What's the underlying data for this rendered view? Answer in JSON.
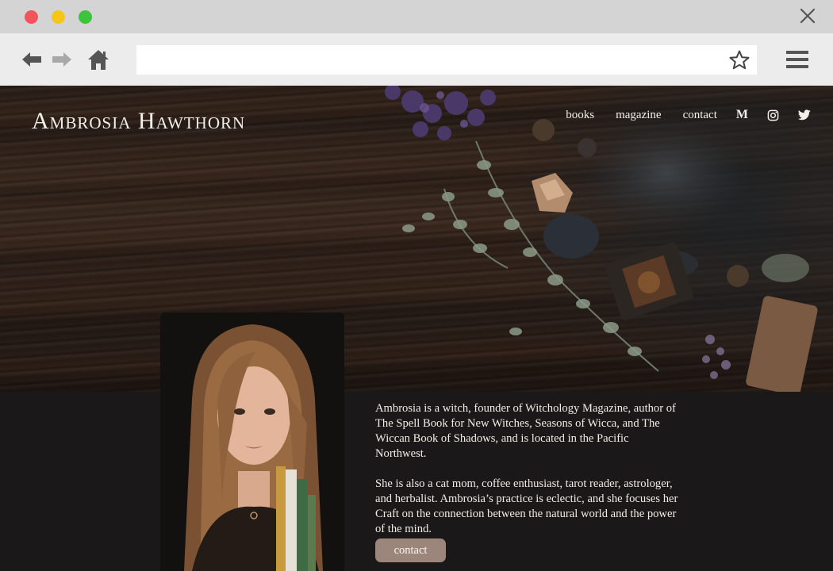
{
  "browser": {
    "url": ""
  },
  "site": {
    "brand": "Ambrosia Hawthorn",
    "nav": {
      "books": "books",
      "magazine": "magazine",
      "contact": "contact",
      "medium": "M"
    },
    "icons": [
      "back-icon",
      "forward-icon",
      "home-icon",
      "star-icon",
      "menu-icon",
      "close-icon",
      "medium-icon",
      "instagram-icon",
      "twitter-icon"
    ],
    "colors": {
      "background": "#1a1818",
      "button": "#9c857b",
      "text": "#f1ede7"
    }
  },
  "bio": {
    "paragraph1": "Ambrosia is a witch, founder of Witchology Magazine, author of The Spell Book for New Witches, Seasons of Wicca, and The Wiccan Book of Shadows, and is located in the Pacific Northwest.",
    "paragraph2": "She is also a cat mom, coffee enthusiast, tarot reader, astrologer, and herbalist. Ambrosia’s practice is eclectic, and she focuses her Craft on the connection between the natural world and the power of the mind.",
    "contact_label": "contact"
  }
}
